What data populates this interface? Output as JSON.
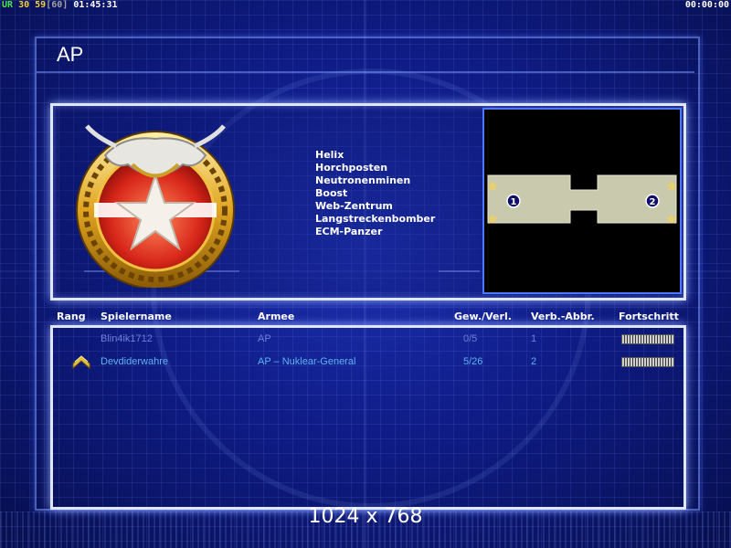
{
  "status_bar": {
    "ur_label": "UR",
    "value_a": "30",
    "value_b": "59",
    "value_c": "[60]",
    "clock": "01:45:31",
    "timer": "00:00:00"
  },
  "window": {
    "title": "AP"
  },
  "emblem": {
    "icon": "dragon-star-emblem-icon"
  },
  "units": [
    "Helix",
    "Horchposten",
    "Neutronenminen",
    "Boost",
    "Web-Zentrum",
    "Langstreckenbomber",
    "ECM-Panzer"
  ],
  "minimap": {
    "start_positions": [
      "1",
      "2"
    ]
  },
  "table": {
    "headers": {
      "rank": "Rang",
      "player": "Spielername",
      "army": "Armee",
      "winloss": "Gew./Verl.",
      "disconnect": "Verb.-Abbr.",
      "progress": "Fortschritt"
    },
    "rows": [
      {
        "player": "Blin4ik1712",
        "army": "AP",
        "winloss": "0/5",
        "disconnect": "1",
        "rank_icon": ""
      },
      {
        "player": "Devdiderwahre",
        "army": "AP – Nuklear-General",
        "winloss": "5/26",
        "disconnect": "2",
        "rank_icon": "rank-chevron-icon"
      }
    ]
  },
  "resolution_label": "1024 x 768",
  "colors": {
    "background": "#0f1c86",
    "panel_border": "#dfe6ff",
    "row_text_dim": "#6f7fd4",
    "row_text_active": "#5db3f0"
  }
}
